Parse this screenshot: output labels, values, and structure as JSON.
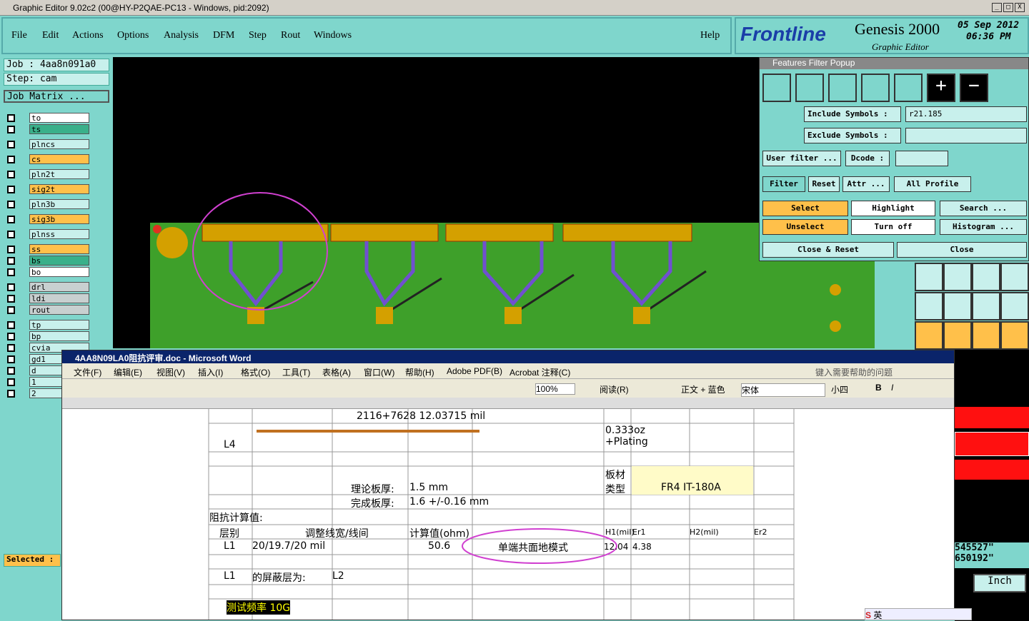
{
  "window": {
    "title": "Graphic Editor 9.02c2 (00@HY-P2QAE-PC13 - Windows, pid:2092)"
  },
  "menu": [
    "File",
    "Edit",
    "Actions",
    "Options",
    "Analysis",
    "DFM",
    "Step",
    "Rout",
    "Windows"
  ],
  "help": "Help",
  "logo": {
    "brand": "Frontline",
    "product": "Genesis 2000",
    "sub": "Graphic Editor",
    "date": "05 Sep 2012",
    "time": "06:36 PM"
  },
  "job": "Job : 4aa8n091a0",
  "step": "Step: cam",
  "job_matrix": "Job Matrix ...",
  "layers": [
    "to",
    "ts",
    "plncs",
    "cs",
    "pln2t",
    "sig2t",
    "pln3b",
    "sig3b",
    "plnss",
    "ss",
    "bs",
    "bo",
    "drl",
    "ldi",
    "rout",
    "tp",
    "bp",
    "cvia",
    "gd1",
    "d",
    "1",
    "2"
  ],
  "selected": "Selected :",
  "ffp": {
    "title": "Features Filter Popup",
    "include": "Include Symbols :",
    "include_val": "r21.185",
    "exclude": "Exclude Symbols :",
    "user_filter": "User filter ...",
    "dcode": "Dcode :",
    "filter": "Filter",
    "reset": "Reset",
    "attr": "Attr ...",
    "all_profile": "All Profile",
    "select": "Select",
    "highlight": "Highlight",
    "search": "Search ...",
    "unselect": "Unselect",
    "turn_off": "Turn off",
    "histogram": "Histogram ...",
    "close_reset": "Close & Reset",
    "close": "Close"
  },
  "coords": {
    "x": "545527\"",
    "y": "650192\"",
    "unit": "Inch"
  },
  "word": {
    "title": "4AA8N09LA0阻抗评审.doc - Microsoft Word",
    "menus": [
      "文件(F)",
      "编辑(E)",
      "视图(V)",
      "插入(I)",
      "格式(O)",
      "工具(T)",
      "表格(A)",
      "窗口(W)",
      "帮助(H)",
      "Adobe PDF(B)",
      "Acrobat 注释(C)"
    ],
    "help_box": "键入需要帮助的问题",
    "zoom": "100%",
    "style": "正文 + 蓝色",
    "font": "宋体",
    "size": "小四",
    "read": "阅读(R)"
  },
  "doc": {
    "stack": "2116+7628   12.03715 mil",
    "l4": "L4",
    "copper": "0.333oz +Plating",
    "board_type": "板材类型",
    "material": "FR4 IT-180A",
    "thick_theory": "理论板厚:",
    "thick_theory_val": "1.5 mm",
    "thick_final": "完成板厚:",
    "thick_final_val": "1.6 +/-0.16 mm",
    "imp_calc": "阻抗计算值:",
    "h_layer": "层别",
    "h_adjust": "调整线宽/线间",
    "h_calc": "计算值(ohm)",
    "h_h1": "H1(mil)",
    "h_er1": "Er1",
    "h_h2": "H2(mil)",
    "h_er2": "Er2",
    "r_layer": "L1",
    "r_adjust": "20/19.7/20 mil",
    "r_calc": "50.6",
    "r_mode": "单端共面地模式",
    "r_h1": "12.04",
    "r_er1": "4.38",
    "shield_layer": "L1",
    "shield_label": "的屏蔽层为:",
    "shield_val": "L2",
    "freq": "测试频率 10G"
  },
  "ime": "英"
}
